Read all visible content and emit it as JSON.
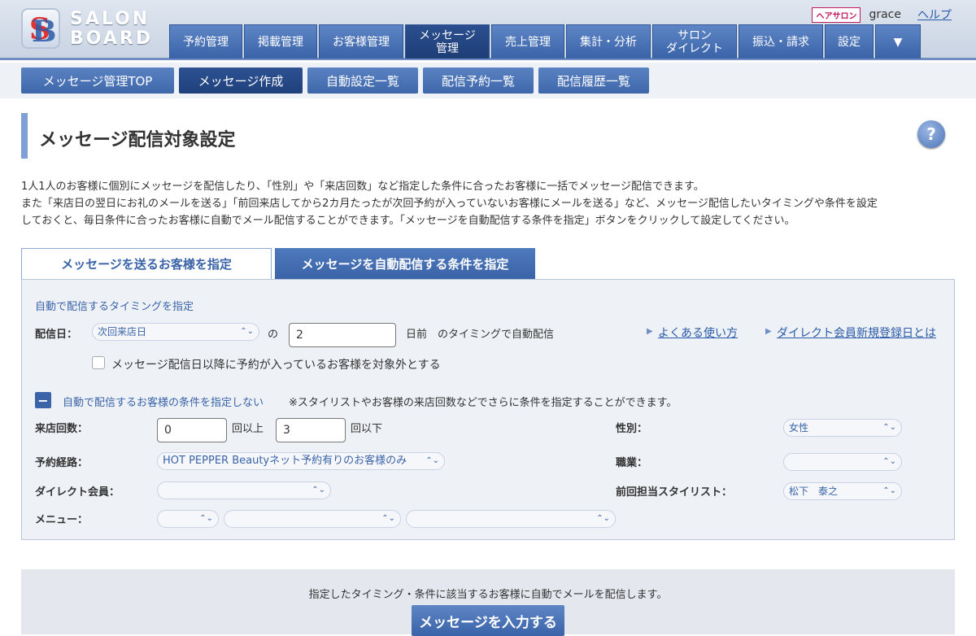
{
  "header": {
    "logo_line1": "SALON",
    "logo_line2": "BOARD",
    "salon_badge": "ヘアサロン",
    "username": "grace",
    "help": "ヘルプ"
  },
  "nav": {
    "items": [
      {
        "label": "予約管理"
      },
      {
        "label": "掲載管理"
      },
      {
        "label": "お客様管理"
      },
      {
        "label": "メッセージ\n管理"
      },
      {
        "label": "売上管理"
      },
      {
        "label": "集計・分析"
      },
      {
        "label": "サロン\nダイレクト"
      },
      {
        "label": "振込・請求"
      },
      {
        "label": "設定"
      },
      {
        "label": "▼"
      }
    ]
  },
  "subnav": {
    "items": [
      {
        "label": "メッセージ管理TOP"
      },
      {
        "label": "メッセージ作成"
      },
      {
        "label": "自動設定一覧"
      },
      {
        "label": "配信予約一覧"
      },
      {
        "label": "配信履歴一覧"
      }
    ]
  },
  "page": {
    "title": "メッセージ配信対象設定",
    "help_icon": "?",
    "desc_line1": "1人1人のお客様に個別にメッセージを配信したり、「性別」や「来店回数」など指定した条件に合ったお客様に一括でメッセージ配信できます。",
    "desc_line2": "また「来店日の翌日にお礼のメールを送る」「前回来店してから2カ月たったが次回予約が入っていないお客様にメールを送る」など、メッセージ配信したいタイミングや条件を設定",
    "desc_line3": "しておくと、毎日条件に合ったお客様に自動でメール配信することができます。「メッセージを自動配信する条件を指定」ボタンをクリックして設定してください。"
  },
  "tabs": {
    "tab1": "メッセージを送るお客様を指定",
    "tab2": "メッセージを自動配信する条件を指定"
  },
  "form": {
    "timing_heading": "自動で配信するタイミングを指定",
    "delivery_label": "配信日：",
    "delivery_select": "次回来店日",
    "no_label": "の",
    "days_value": "2",
    "days_suffix": "日前　のタイミングで自動配信",
    "faq_link": "よくある使い方",
    "direct_link": "ダイレクト会員新規登録日とは",
    "exclude_checkbox": "メッセージ配信日以降に予約が入っているお客様を対象外とする",
    "condition_toggle": "自動で配信するお客様の条件を指定しない",
    "condition_note": "※スタイリストやお客様の来店回数などでさらに条件を指定することができます。",
    "visit_count_label": "来店回数：",
    "visit_min": "0",
    "visit_min_suffix": "回以上",
    "visit_max": "3",
    "visit_max_suffix": "回以下",
    "gender_label": "性別：",
    "gender_value": "女性",
    "route_label": "予約経路：",
    "route_value": "HOT PEPPER Beautyネット予約有りのお客様のみ",
    "job_label": "職業：",
    "job_value": "",
    "direct_member_label": "ダイレクト会員：",
    "direct_member_value": "",
    "stylist_label": "前回担当スタイリスト：",
    "stylist_value": "松下　泰之",
    "menu_label": "メニュー：",
    "menu_value1": "",
    "menu_value2": "",
    "menu_value3": ""
  },
  "bottom": {
    "text": "指定したタイミング・条件に該当するお客様に自動でメールを配信します。",
    "button": "メッセージを入力する"
  }
}
